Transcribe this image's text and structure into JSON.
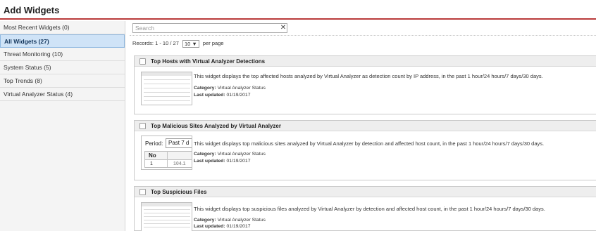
{
  "page": {
    "title": "Add Widgets"
  },
  "sidebar": {
    "items": [
      {
        "label": "Most Recent Widgets (0)"
      },
      {
        "label": "All Widgets (27)"
      },
      {
        "label": "Threat Monitoring (10)"
      },
      {
        "label": "System Status (5)"
      },
      {
        "label": "Top Trends (8)"
      },
      {
        "label": "Virtual Analyzer Status (4)"
      }
    ],
    "active_index": 1
  },
  "search": {
    "placeholder": "Search",
    "value": ""
  },
  "records": {
    "text": "Records: 1 - 10 / 27",
    "per_page_value": "10 ▼",
    "per_page_suffix": "per page"
  },
  "widgets": [
    {
      "title": "Top Hosts with Virtual Analyzer Detections",
      "description": "This widget displays the top affected hosts analyzed by Virtual Analyzer as detection count by IP address, in the past 1 hour/24 hours/7 days/30 days.",
      "category_label": "Category:",
      "category": "Virtual Analyzer Status",
      "updated_label": "Last updated:",
      "updated": "01/19/2017"
    },
    {
      "title": "Top Malicious Sites Analyzed by Virtual Analyzer",
      "description": "This widget displays top malicious sites analyzed by Virtual Analyzer by detection and affected host count, in the past 1 hour/24 hours/7 days/30 days.",
      "category_label": "Category:",
      "category": "Virtual Analyzer Status",
      "updated_label": "Last updated:",
      "updated": "01/19/2017",
      "preview": {
        "period_label": "Period:",
        "period_value": "Past 7 d",
        "col_no": "No",
        "row_no": "1",
        "row_value": "104.1"
      }
    },
    {
      "title": "Top Suspicious Files",
      "description": "This widget displays top suspicious files analyzed by Virtual Analyzer by detection and affected host count, in the past 1 hour/24 hours/7 days/30 days.",
      "category_label": "Category:",
      "category": "Virtual Analyzer Status",
      "updated_label": "Last updated:",
      "updated": "01/19/2017"
    }
  ],
  "icons": {
    "clear": "close-icon",
    "checkbox": "checkbox-icon"
  },
  "colors": {
    "header_rule": "#b93a3a",
    "active_bg": "#cfe3f7",
    "card_header": "#eeeeee"
  }
}
